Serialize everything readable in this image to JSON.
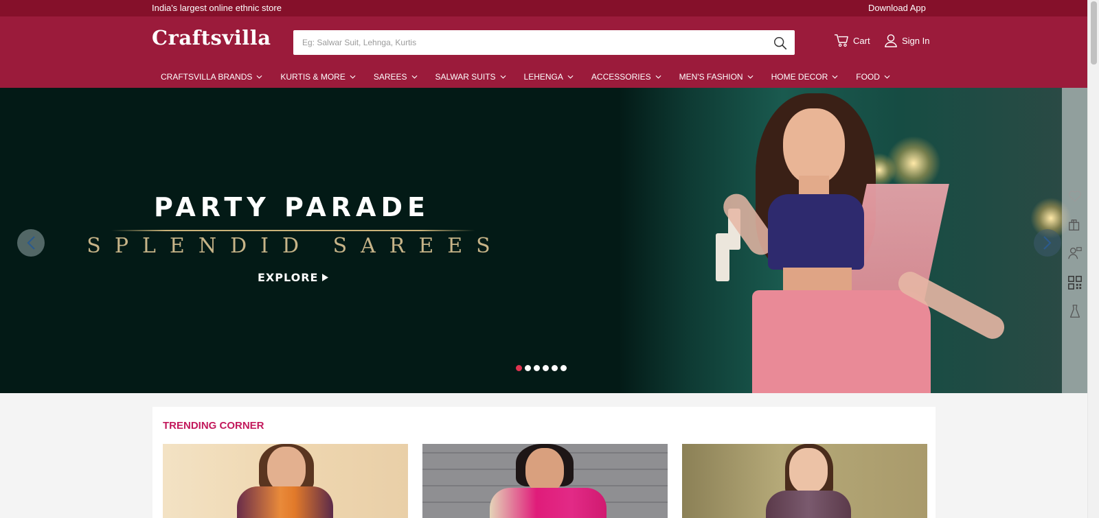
{
  "topbar": {
    "tagline": "India's largest online ethnic store",
    "download_app": "Download App"
  },
  "header": {
    "logo": "Craftsvilla",
    "search_placeholder": "Eg: Salwar Suit, Lehnga, Kurtis",
    "cart_label": "Cart",
    "signin_label": "Sign In"
  },
  "nav": [
    {
      "label": "CRAFTSVILLA BRANDS"
    },
    {
      "label": "KURTIS & MORE"
    },
    {
      "label": "SAREES"
    },
    {
      "label": "SALWAR SUITS"
    },
    {
      "label": "LEHENGA"
    },
    {
      "label": "ACCESSORIES"
    },
    {
      "label": "MEN'S FASHION"
    },
    {
      "label": "HOME DECOR"
    },
    {
      "label": "FOOD"
    }
  ],
  "hero": {
    "title": "PARTY PARADE",
    "subtitle": "SPLENDID SAREES",
    "cta": "EXPLORE",
    "slide_count": 6,
    "active_slide": 1
  },
  "sidetools": [
    "heart-icon",
    "gift-icon",
    "person-icon",
    "qr-code-icon",
    "dress-icon"
  ],
  "trending": {
    "title": "TRENDING CORNER"
  },
  "colors": {
    "brand": "#9b1b3b",
    "brand_dark": "#85102a",
    "accent": "#c2185b",
    "dot_active": "#e0334f"
  }
}
